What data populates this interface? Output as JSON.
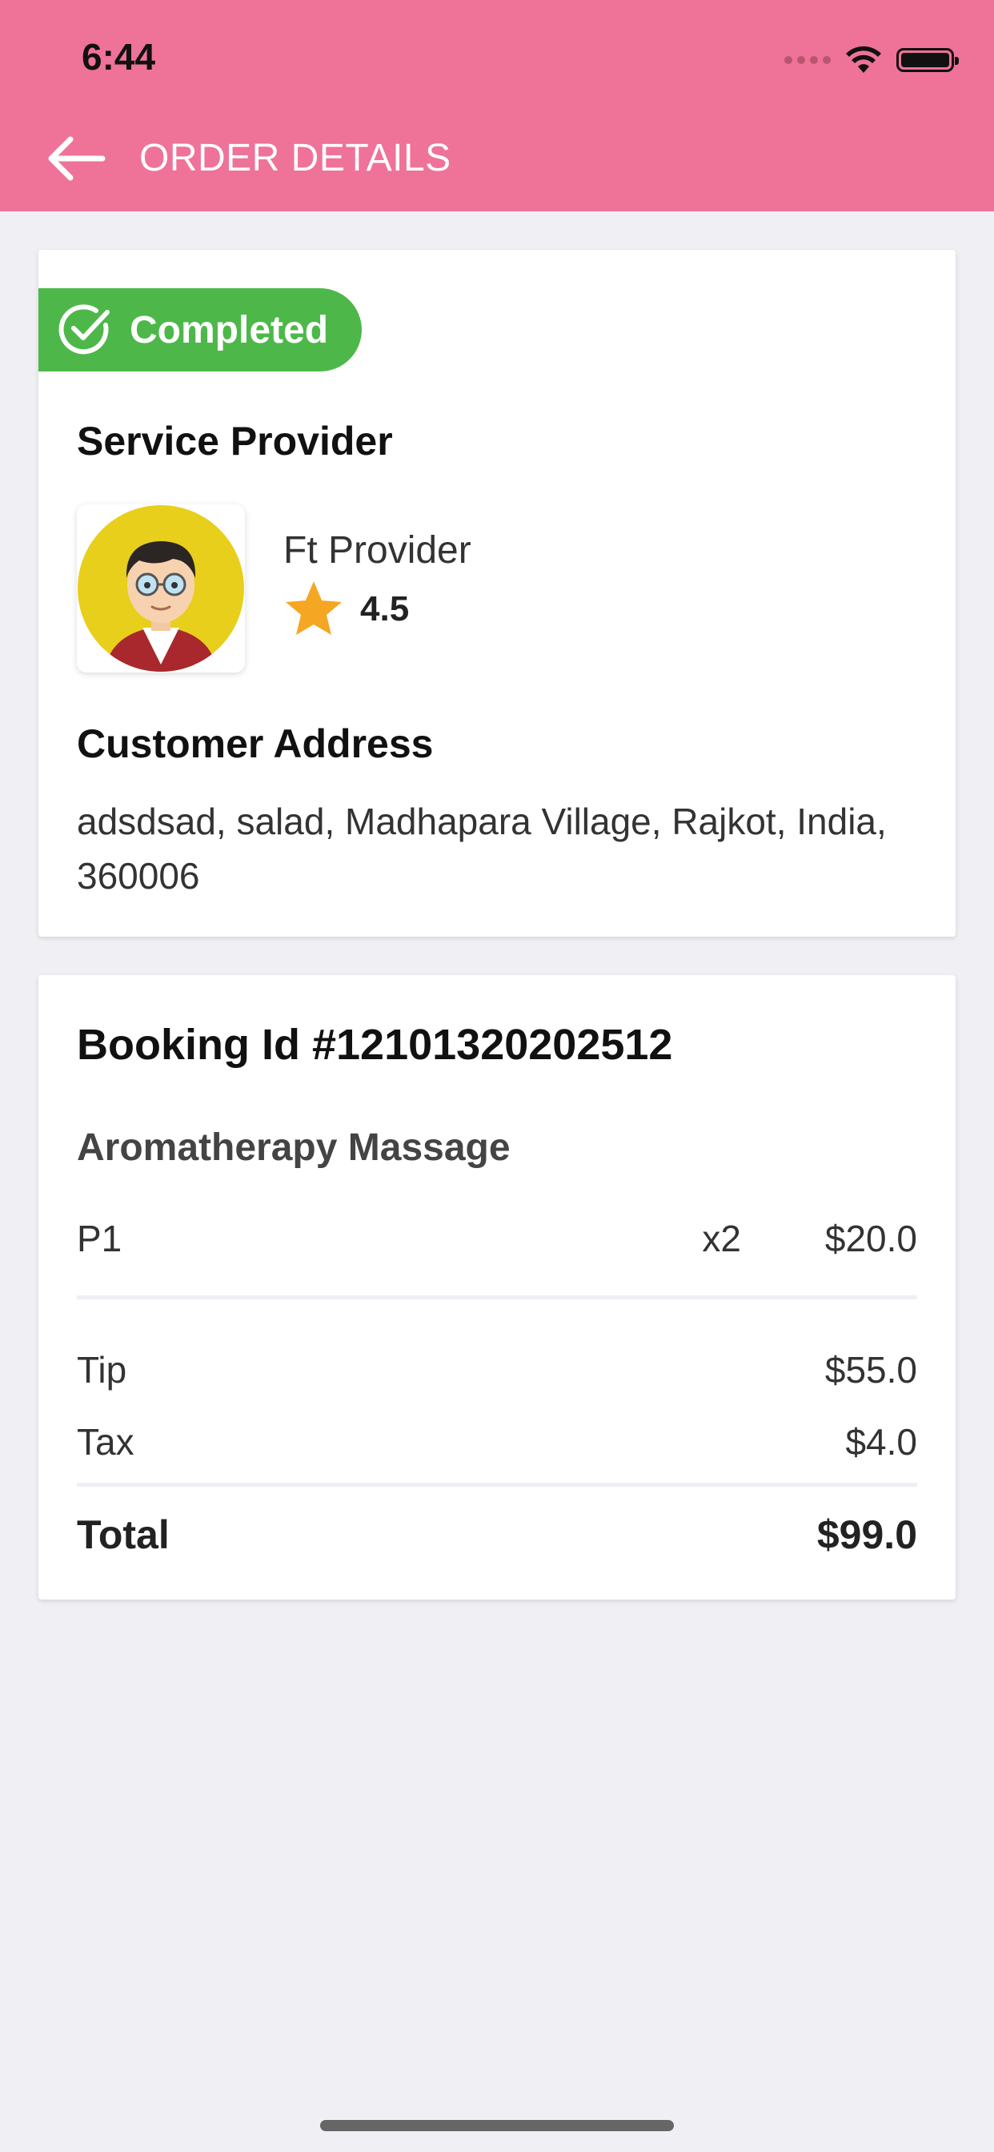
{
  "status_bar": {
    "time": "6:44"
  },
  "header": {
    "title": "ORDER DETAILS",
    "back_icon": "arrow-left-icon"
  },
  "colors": {
    "header_bg": "#ef7299",
    "badge_bg": "#4db849",
    "star": "#f5a623",
    "page_bg": "#efeff4"
  },
  "order_card": {
    "status": "Completed",
    "service_provider_heading": "Service Provider",
    "provider": {
      "name": "Ft Provider",
      "rating": "4.5"
    },
    "address_heading": "Customer Address",
    "address": "adsdsad, salad, Madhapara Village, Rajkot, India, 360006"
  },
  "booking_card": {
    "booking_id": "Booking Id #12101320202512",
    "service_name": "Aromatherapy Massage",
    "items": [
      {
        "name": "P1",
        "qty": "x2",
        "price": "$20.0"
      }
    ],
    "charges": [
      {
        "label": "Tip",
        "value": "$55.0"
      },
      {
        "label": "Tax",
        "value": "$4.0"
      }
    ],
    "total": {
      "label": "Total",
      "value": "$99.0"
    }
  }
}
